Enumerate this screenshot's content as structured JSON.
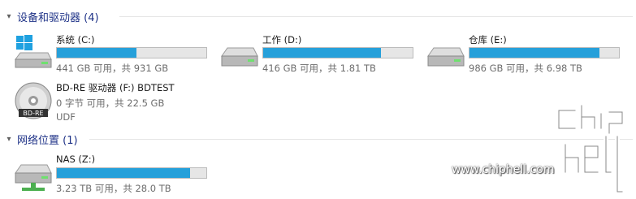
{
  "sections": [
    {
      "title": "设备和驱动器 (4)",
      "drives": [
        {
          "name": "系统 (C:)",
          "icon": "windows-drive-icon",
          "used_fraction": 0.53,
          "detail": "441 GB 可用，共 931 GB"
        },
        {
          "name": "工作 (D:)",
          "icon": "hard-drive-icon",
          "used_fraction": 0.79,
          "detail": "416 GB 可用，共 1.81 TB"
        },
        {
          "name": "仓库 (E:)",
          "icon": "hard-drive-icon",
          "used_fraction": 0.87,
          "detail": "986 GB 可用，共 6.98 TB"
        },
        {
          "name": "BD-RE 驱动器 (F:) BDTEST",
          "icon": "optical-disc-icon",
          "icon_label": "BD-RE",
          "detail": "0 字节 可用，共 22.5 GB",
          "filesystem": "UDF"
        }
      ]
    },
    {
      "title": "网络位置 (1)",
      "drives": [
        {
          "name": "NAS (Z:)",
          "icon": "network-drive-icon",
          "used_fraction": 0.89,
          "detail": "3.23 TB 可用，共 28.0 TB"
        }
      ]
    }
  ],
  "watermark": {
    "site": "www.chiphell.com",
    "logo_text": "chip hell"
  },
  "colors": {
    "bar_fill": "#26a0da",
    "bar_track": "#e6e6e6",
    "header_text": "#1e3287"
  }
}
